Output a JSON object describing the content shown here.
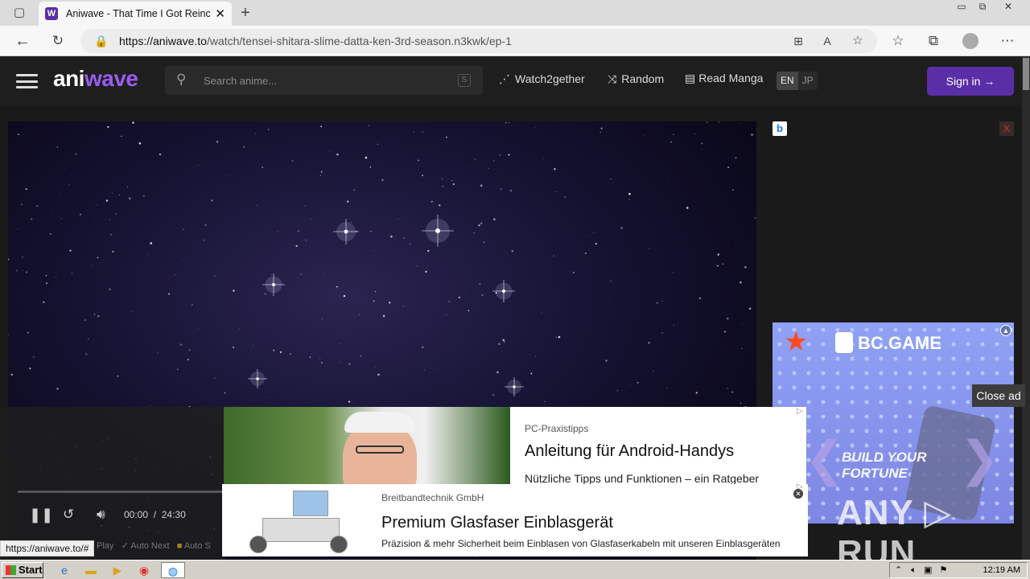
{
  "browser": {
    "tab_title": "Aniwave - That Time I Got Reinca",
    "tab_favicon": "W",
    "tab_close": "✕",
    "new_tab": "+",
    "url_host": "https://aniwave.to",
    "url_path": "/watch/tensei-shitara-slime-datta-ken-3rd-season.n3kwk/ep-1",
    "window_buttons": [
      "▭",
      "⧉",
      "✕"
    ]
  },
  "site": {
    "logo_a": "ani",
    "logo_b": "wave",
    "search_placeholder": "Search anime...",
    "search_key": "S",
    "nav": {
      "watch2gether": "Watch2gether",
      "random": "Random",
      "read_manga": "Read Manga"
    },
    "lang_en": "EN",
    "lang_jp": "JP",
    "signin": "Sign in"
  },
  "player": {
    "time_current": "00:00",
    "time_sep": "/",
    "time_total": "24:30",
    "toggle_play": "Play",
    "toggle_autonext": "Auto Next",
    "toggle_autoskip": "Auto S"
  },
  "ads": {
    "bc_logo": "BC.GAME",
    "bc_tagline": "BUILD YOUR FORTUNE",
    "close_ad": "Close ad",
    "ad_x": "X",
    "ad1_source": "PC-Praxistipps",
    "ad1_title": "Anleitung für Android-Handys",
    "ad1_desc": "Nützliche Tipps und Funktionen – ein Ratgeber",
    "ad2_source": "Breitbandtechnik GmbH",
    "ad2_title": "Premium Glasfaser Einblasgerät",
    "ad2_desc": "Präzision & mehr Sicherheit beim Einblasen von Glasfaserkabeln mit unseren Einblasgeräten",
    "watermark": "ANY ▷ RUN"
  },
  "status_url": "https://aniwave.to/#",
  "taskbar": {
    "start": "Start",
    "clock": "12:19 AM"
  },
  "colors": {
    "accent": "#5a2ea6",
    "logo_accent": "#9b5cf0"
  }
}
